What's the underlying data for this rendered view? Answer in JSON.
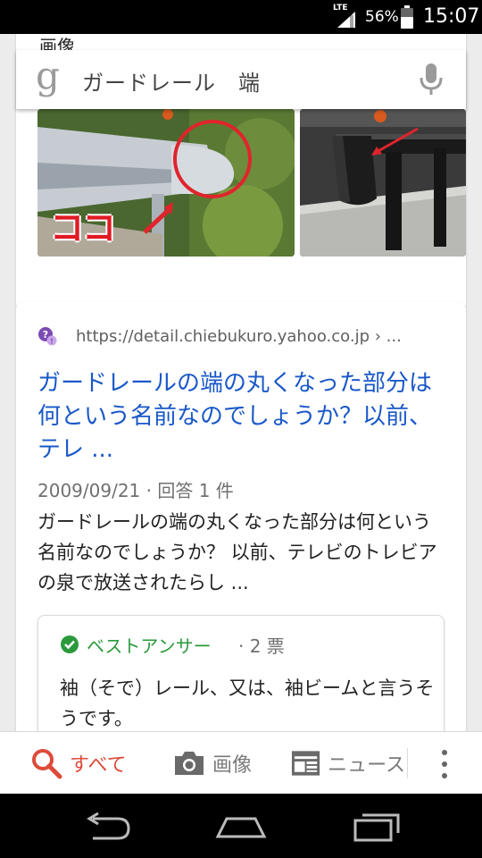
{
  "status_bar": {
    "network": "LTE",
    "battery_percent": "56%",
    "time": "15:07",
    "icons": [
      "signal-icon",
      "battery-icon"
    ]
  },
  "top_card": {
    "cut_heading": "画像",
    "images": [
      {
        "overlay_text": "ココ",
        "icon": "guardrail-photo"
      },
      {
        "icon": "guardrail-photo"
      }
    ]
  },
  "search": {
    "logo_glyph": "g",
    "query": "ガードレール　端",
    "icons": [
      "google-g-icon",
      "mic-icon"
    ]
  },
  "result": {
    "url": "https://detail.chiebukuro.yahoo.co.jp › ...",
    "title": "ガードレールの端の丸くなった部分は何という名前なのでしょうか？以前、テレ ...",
    "meta": "2009/09/21 · 回答 1 件",
    "snippet": "ガードレールの端の丸くなった部分は何という名前なのでしょうか？ 以前、テレビのトレビアの泉で放送されたらし ...",
    "answer": {
      "label": "ベストアンサー",
      "votes": "· 2 票",
      "text": "袖（そで）レール、又は、袖ビームと言うそうです。"
    }
  },
  "tabs": {
    "all": "すべて",
    "images": "画像",
    "news": "ニュース"
  },
  "colors": {
    "link": "#1a58c8",
    "active_tab": "#dd4b39",
    "best_answer": "#2a9a3c"
  }
}
